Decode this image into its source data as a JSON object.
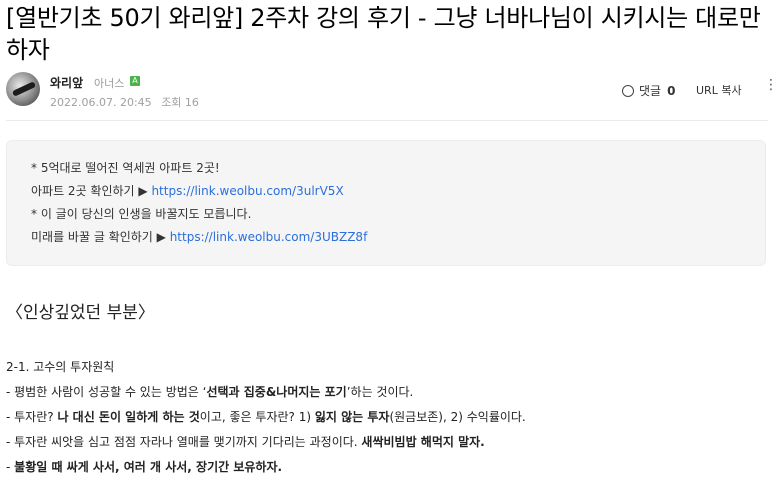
{
  "post": {
    "title": "[열반기초 50기 와리앞] 2주차 강의 후기 - 그냥 너바나님이 시키시는 대로만 하자"
  },
  "author": {
    "name": "와리앞",
    "grade": "아너스",
    "grade_badge": "A",
    "date": "2022.06.07. 20:45",
    "views_label": "조회 16"
  },
  "actions": {
    "comment_label": "댓글",
    "comment_count": "0",
    "url_copy_label": "URL 복사",
    "more_glyph": "⋮"
  },
  "ad": {
    "line1": "* 5억대로 떨어진 역세권 아파트 2곳!",
    "line2_prefix": "아파트 2곳 확인하기 ▶ ",
    "line2_link": "https://link.weolbu.com/3ulrV5X",
    "line3": "* 이 글이 당신의 인생을 바꿀지도 모릅니다.",
    "line4_prefix": "미래를 바꿀 글 확인하기 ▶ ",
    "line4_link": "https://link.weolbu.com/3UBZZ8f"
  },
  "section_heading": "〈인상깊었던 부분〉",
  "content": {
    "subheading": "2-1. 고수의 투자원칙",
    "l1_a": " - 평범한 사람이 성공할 수 있는 방법은 ‘",
    "l1_b": "선택과 집중&나머지는 포기",
    "l1_c": "’하는 것이다.",
    "l2_a": " - 투자란? ",
    "l2_b": "나 대신 돈이 일하게 하는 것",
    "l2_c": "이고, 좋은 투자란? 1) ",
    "l2_d": "잃지 않는 투자",
    "l2_e": "(원금보존), 2) 수익률이다.",
    "l3_a": " - 투자란 씨앗을 심고 점점 자라나 열매를 맺기까지 기다리는 과정이다. ",
    "l3_b": "새싹비빔밥 해먹지 말자.",
    "l4_a": " - ",
    "l4_b": "불황일 때 싸게 사서, 여러 개 사서, 장기간 보유하자."
  }
}
